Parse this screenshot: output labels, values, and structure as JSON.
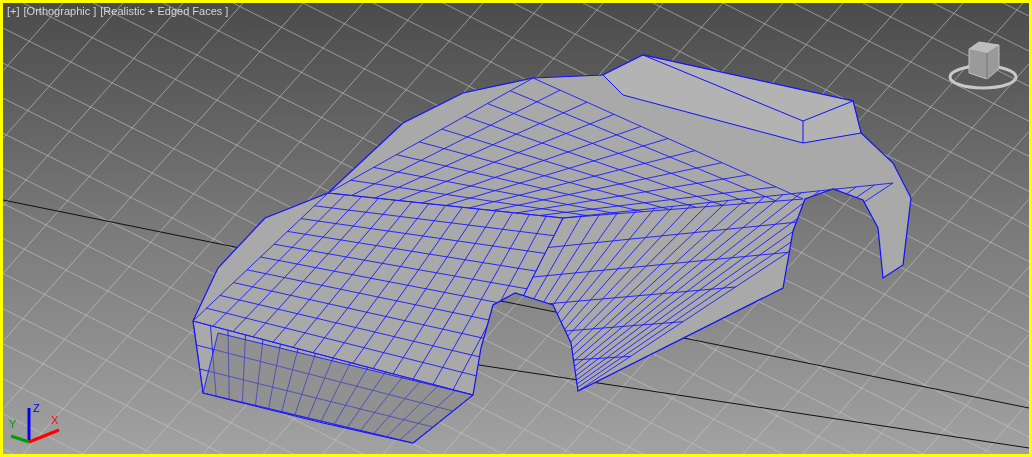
{
  "viewport": {
    "active": true,
    "labels": [
      "[+]",
      "[Orthographic ]",
      "[Realistic + Edged Faces ]"
    ],
    "axis_gizmo": [
      {
        "label": "Z",
        "color": "#0000ff"
      },
      {
        "label": "Y",
        "color": "#00a000"
      },
      {
        "label": "X",
        "color": "#ff0000"
      }
    ]
  }
}
